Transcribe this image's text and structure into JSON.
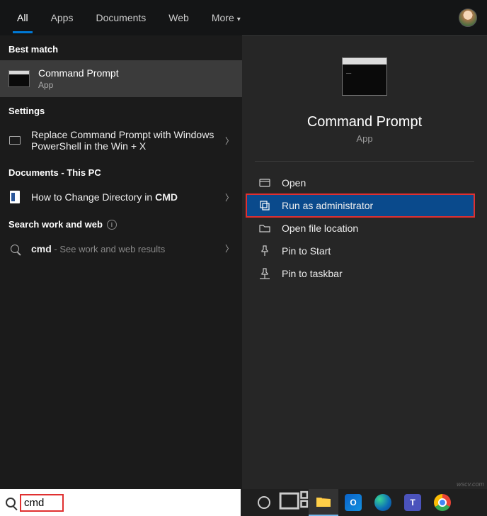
{
  "header": {
    "tabs": [
      "All",
      "Apps",
      "Documents",
      "Web",
      "More"
    ]
  },
  "left": {
    "best_match_label": "Best match",
    "best_match": {
      "title": "Command Prompt",
      "subtitle": "App"
    },
    "settings_label": "Settings",
    "settings_item": "Replace Command Prompt with Windows PowerShell in the Win + X",
    "documents_label": "Documents - This PC",
    "doc_item_prefix": "How to Change Directory in ",
    "doc_item_bold": "CMD",
    "search_section_label": "Search work and web",
    "search_item_bold": "cmd",
    "search_item_hint": " - See work and web results"
  },
  "right": {
    "title": "Command Prompt",
    "subtitle": "App",
    "actions": {
      "open": "Open",
      "run_admin": "Run as administrator",
      "open_location": "Open file location",
      "pin_start": "Pin to Start",
      "pin_taskbar": "Pin to taskbar"
    }
  },
  "taskbar": {
    "search_value": "cmd"
  },
  "watermark": "wscv.com"
}
